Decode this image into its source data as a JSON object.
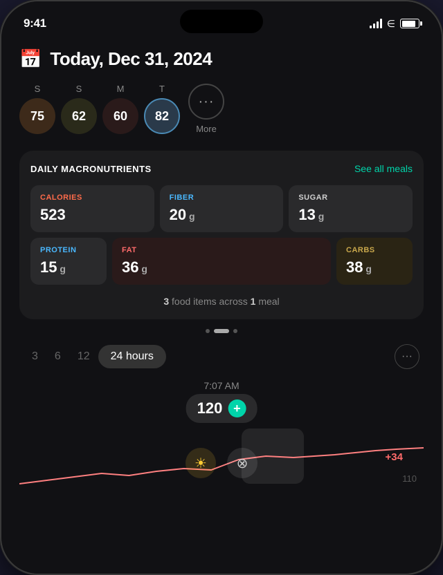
{
  "status": {
    "time": "9:41",
    "battery_indicator": true
  },
  "header": {
    "title": "Today, Dec 31, 2024",
    "calendar_icon": "📅"
  },
  "days": [
    {
      "label": "S",
      "value": "75",
      "style": "sunday1"
    },
    {
      "label": "S",
      "value": "62",
      "style": "sunday2"
    },
    {
      "label": "M",
      "value": "60",
      "style": "monday"
    },
    {
      "label": "T",
      "value": "82",
      "style": "tuesday"
    }
  ],
  "more_button": {
    "label": "More",
    "dots": "···"
  },
  "macros": {
    "section_title": "DAILY MACRONUTRIENTS",
    "see_all_label": "See all meals",
    "calories": {
      "label": "CALORIES",
      "value": "523",
      "unit": ""
    },
    "fiber": {
      "label": "FIBER",
      "value": "20",
      "unit": "g"
    },
    "sugar": {
      "label": "SUGAR",
      "value": "13",
      "unit": "g"
    },
    "protein": {
      "label": "PROTEIN",
      "value": "15",
      "unit": "g"
    },
    "fat": {
      "label": "FAT",
      "value": "36",
      "unit": "g"
    },
    "carbs": {
      "label": "CARBS",
      "value": "38",
      "unit": "g"
    }
  },
  "food_summary": {
    "count": "3",
    "unit": "food items across",
    "meals": "1",
    "meal_label": "meal"
  },
  "time_range": {
    "options": [
      "3",
      "6",
      "12",
      "24 hours"
    ],
    "active": "24 hours"
  },
  "chart": {
    "time_label": "7:07 AM",
    "glucose_value": "120",
    "delta": "+34",
    "chart_number": "110"
  }
}
